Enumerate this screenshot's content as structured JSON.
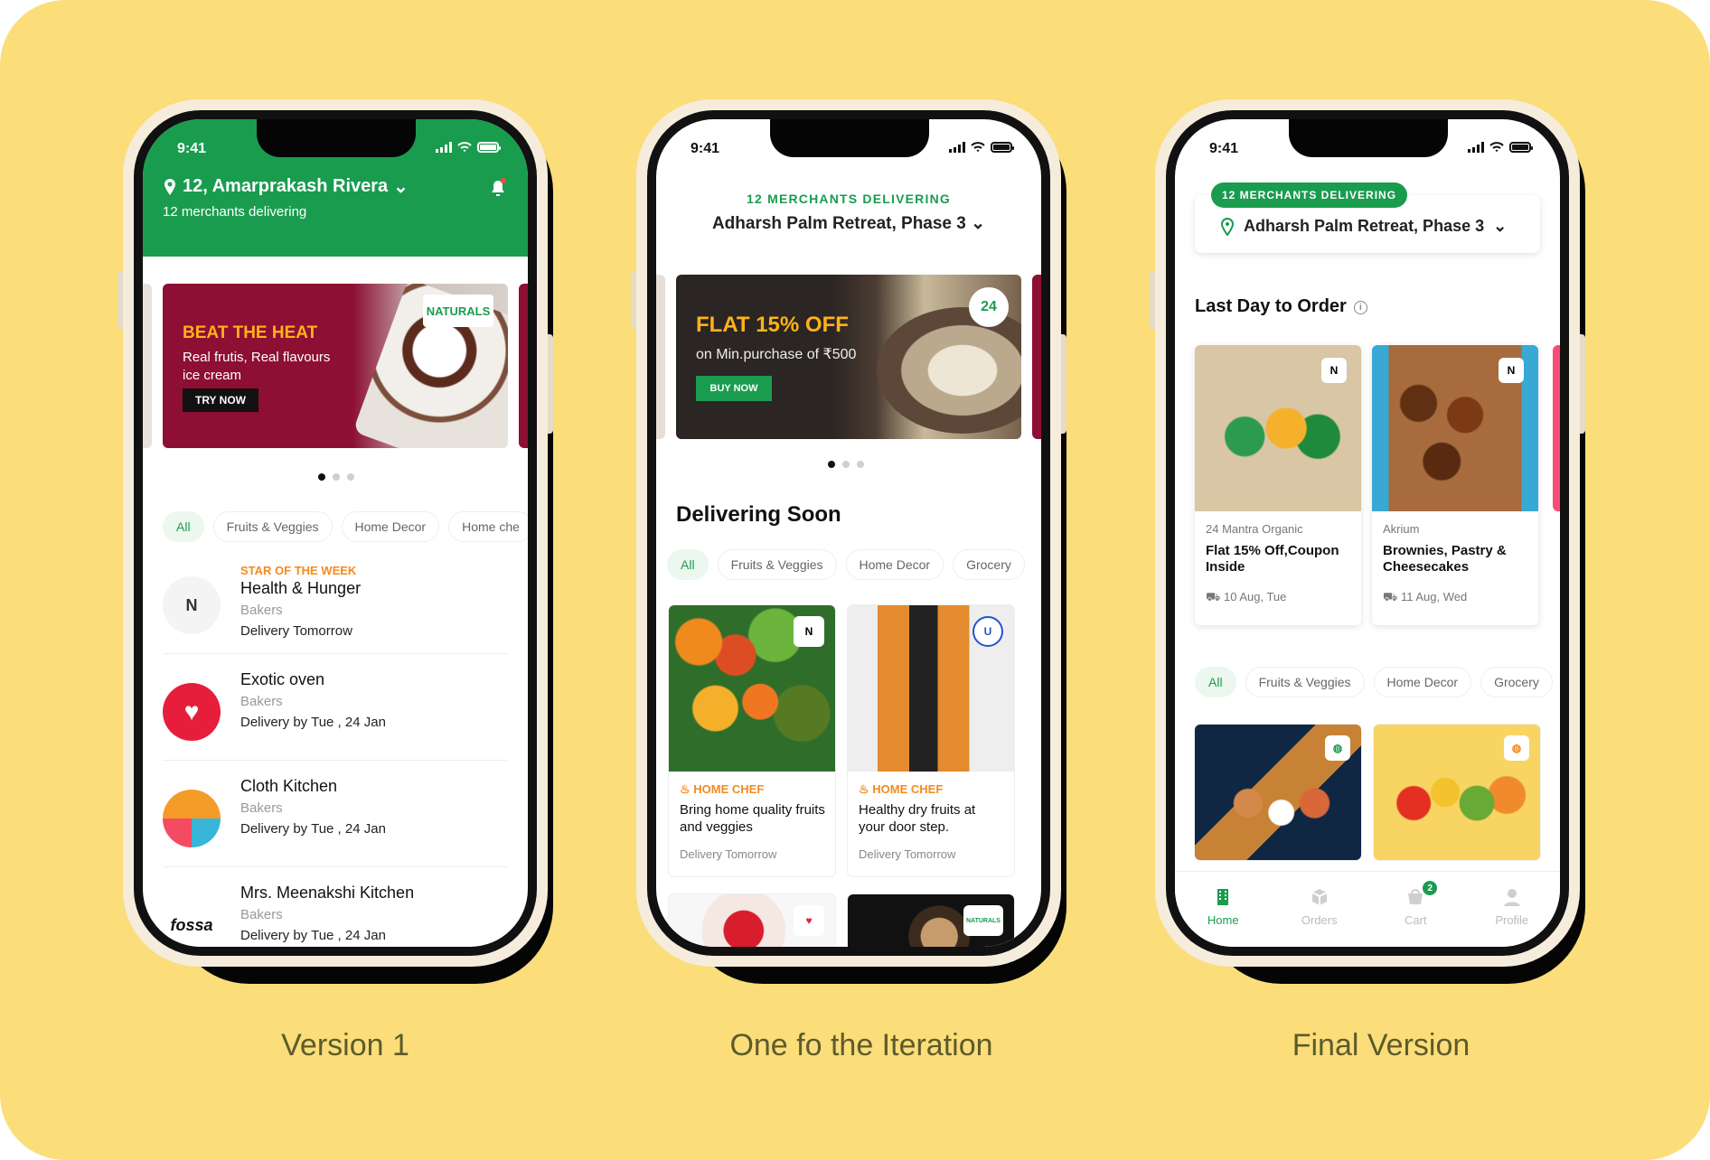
{
  "status": {
    "time": "9:41"
  },
  "labels": {
    "version1": "Version 1",
    "iteration": "One fo the Iteration",
    "final": "Final Version"
  },
  "version1": {
    "header": {
      "location": "12, Amarprakash Rivera",
      "subtitle": "12 merchants delivering"
    },
    "banner": {
      "title": "BEAT THE HEAT",
      "text": "Real frutis, Real flavours ice cream",
      "button": "TRY NOW",
      "brand": "NATURALS"
    },
    "chips": [
      "All",
      "Fruits & Veggies",
      "Home Decor",
      "Home che"
    ],
    "merchants": [
      {
        "tag": "STAR OF THE WEEK",
        "name": "Health & Hunger",
        "category": "Bakers",
        "delivery": "Delivery Tomorrow",
        "avatar": "N"
      },
      {
        "tag": "",
        "name": "Exotic oven",
        "category": "Bakers",
        "delivery": "Delivery by Tue , 24 Jan",
        "avatar": "♥"
      },
      {
        "tag": "",
        "name": "Cloth Kitchen",
        "category": "Bakers",
        "delivery": "Delivery by Tue , 24 Jan",
        "avatar": ""
      },
      {
        "tag": "",
        "name": "Mrs. Meenakshi Kitchen",
        "category": "Bakers",
        "delivery": "Delivery by Tue , 24 Jan",
        "avatar": "fossa"
      }
    ]
  },
  "iteration": {
    "header": {
      "small": "12 MERCHANTS DELIVERING",
      "address": "Adharsh Palm Retreat, Phase 3"
    },
    "banner": {
      "title": "FLAT 15% OFF",
      "text": "on Min.purchase of ₹500",
      "button": "BUY NOW",
      "brand": "24"
    },
    "section": "Delivering Soon",
    "chips": [
      "All",
      "Fruits & Veggies",
      "Home Decor",
      "Grocery"
    ],
    "cards": [
      {
        "type": "HOME CHEF",
        "title": "Bring home quality fruits and veggies",
        "delivery": "Delivery Tomorrow",
        "badge": "N"
      },
      {
        "type": "HOME CHEF",
        "title": "Healthy dry fruits at your door step.",
        "delivery": "Delivery Tomorrow",
        "badge": "U"
      }
    ],
    "more_badges": [
      "♥",
      "NATURALS"
    ]
  },
  "final": {
    "header": {
      "pill": "12 MERCHANTS DELIVERING",
      "address": "Adharsh Palm Retreat, Phase 3"
    },
    "section": "Last Day to Order",
    "offers": [
      {
        "merchant": "24 Mantra Organic",
        "title": "Flat 15% Off,Coupon Inside",
        "date": "10 Aug, Tue",
        "badge": "N"
      },
      {
        "merchant": "Akrium",
        "title": "Brownies, Pastry & Cheesecakes",
        "date": "11 Aug, Wed",
        "badge": "N"
      }
    ],
    "chips": [
      "All",
      "Fruits & Veggies",
      "Home Decor",
      "Grocery"
    ],
    "nav": [
      {
        "label": "Home",
        "icon": "home-icon"
      },
      {
        "label": "Orders",
        "icon": "orders-icon"
      },
      {
        "label": "Cart",
        "icon": "cart-icon",
        "count": "2"
      },
      {
        "label": "Profile",
        "icon": "profile-icon"
      }
    ]
  }
}
